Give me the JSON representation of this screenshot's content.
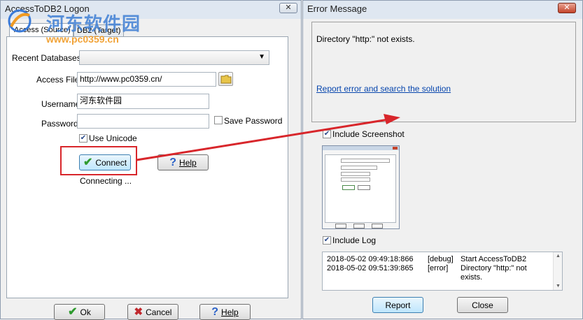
{
  "logon_window": {
    "title": "AccessToDB2 Logon",
    "close_label": "✕",
    "tabs": [
      "Access (Source)",
      "DB2 (Target)"
    ],
    "recent_databases_label": "Recent Databases",
    "recent_databases_value": "",
    "access_file_label": "Access File",
    "access_file_value": "http://www.pc0359.cn/",
    "username_label": "Username",
    "username_value": "河东软件园",
    "password_label": "Password",
    "password_value": "",
    "save_password_label": "Save Password",
    "save_password_checked": false,
    "use_unicode_label": "Use Unicode",
    "use_unicode_checked": true,
    "connect_label": "Connect",
    "help_label": "Help",
    "status_text": "Connecting ...",
    "ok_label": "Ok",
    "cancel_label": "Cancel",
    "bottom_help_label": "Help"
  },
  "error_window": {
    "title": "Error Message",
    "close_label": "✕",
    "message": "Directory \"http:\" not exists.",
    "report_link": "Report error and search the solution",
    "include_screenshot_label": "Include Screenshot",
    "include_screenshot_checked": true,
    "include_log_label": "Include Log",
    "include_log_checked": true,
    "log_rows": [
      {
        "time": "2018-05-02 09:49:18:866",
        "level": "[debug]",
        "text": "Start AccessToDB2"
      },
      {
        "time": "2018-05-02 09:51:39:865",
        "level": "[error]",
        "text": "Directory \"http:\" not exists."
      }
    ],
    "report_button": "Report",
    "close_button": "Close"
  },
  "watermark": {
    "name": "河东软件园",
    "url": "www.pc0359.cn"
  },
  "colors": {
    "highlight_red": "#d8262b",
    "link_blue": "#0645ad",
    "check_green": "#2e9a2e",
    "help_blue": "#2b62c8",
    "cancel_red": "#c0282d",
    "watermark_orange": "#f09a23"
  }
}
